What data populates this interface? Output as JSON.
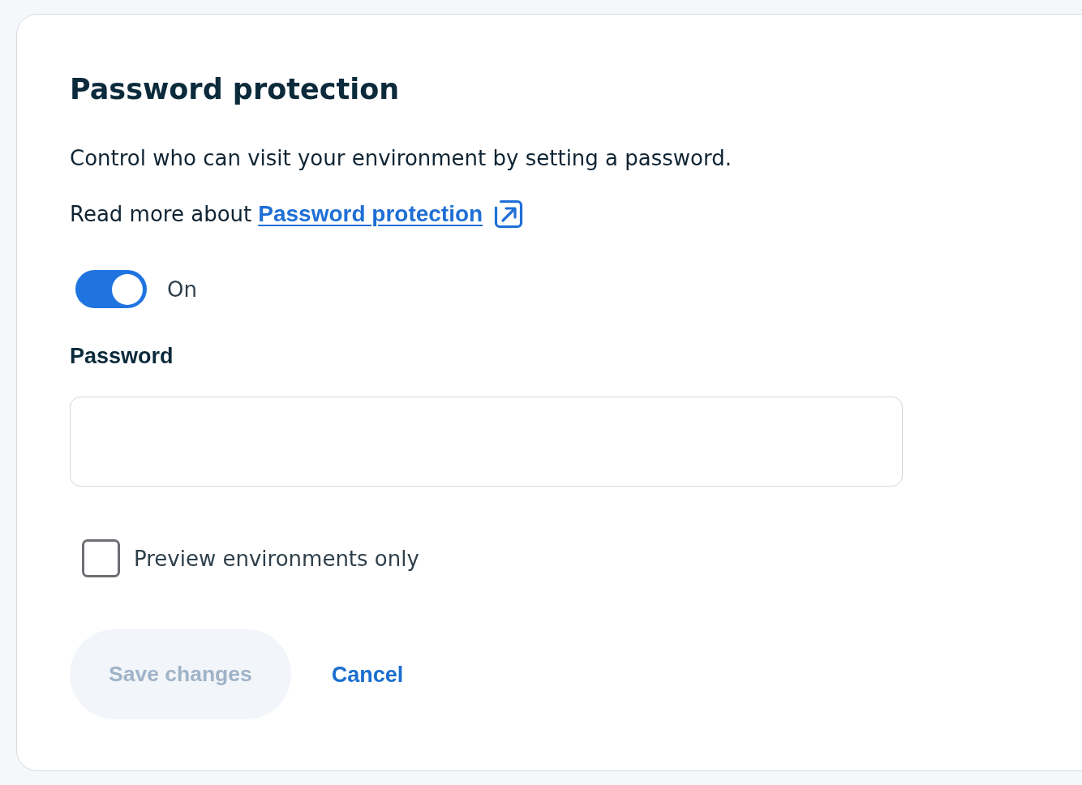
{
  "card": {
    "title": "Password protection",
    "description": "Control who can visit your environment by setting a password.",
    "read_more": {
      "text": "Read more about",
      "link": "Password protection"
    },
    "toggle": {
      "on": true,
      "label": "On"
    },
    "password_field": {
      "label": "Password"
    },
    "checkbox": {
      "label": "Preview environments only",
      "checked": false
    },
    "buttons": [
      {
        "label": "Save changes",
        "kind": "primary",
        "disabled": true
      },
      {
        "label": "Cancel",
        "kind": "link",
        "disabled": false
      }
    ]
  }
}
